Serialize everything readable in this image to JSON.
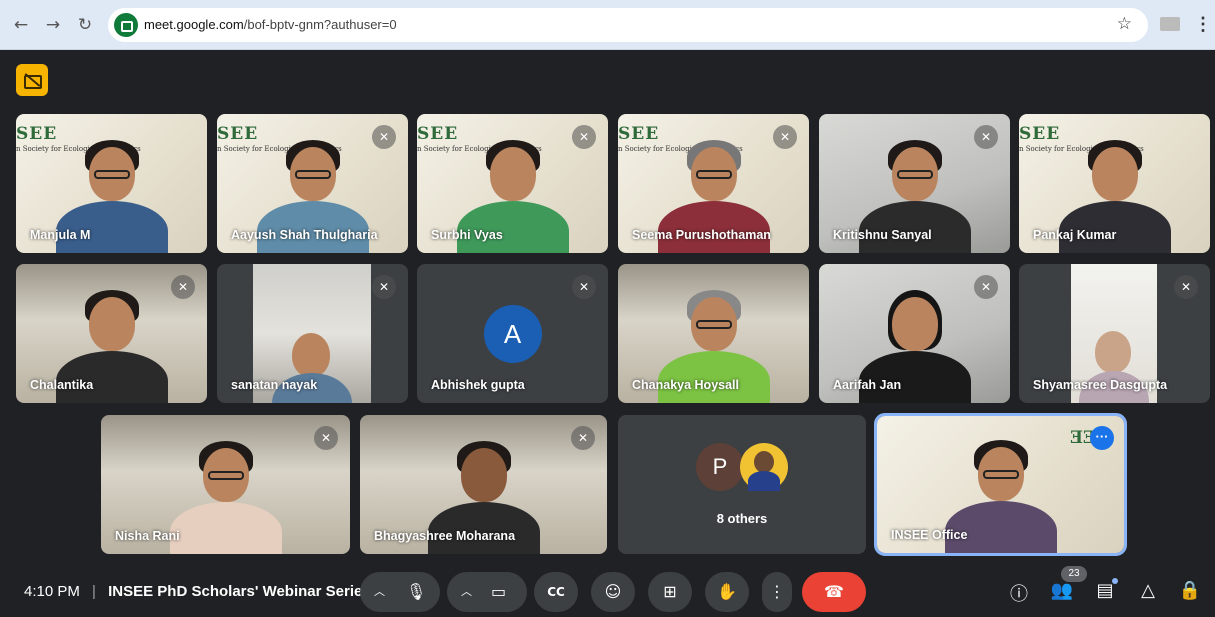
{
  "browser": {
    "url_host": "meet.google.com",
    "url_path": "/bof-bptv-gnm?authuser=0"
  },
  "banner": {
    "big": "SEE",
    "small": "n Society for Ecological Economics"
  },
  "tiles": [
    {
      "name": "Manjula M",
      "muted": false
    },
    {
      "name": "Aayush Shah Thulgharia",
      "muted": true
    },
    {
      "name": "Surbhi Vyas",
      "muted": true
    },
    {
      "name": "Seema Purushothaman",
      "muted": true
    },
    {
      "name": "Kritishnu Sanyal",
      "muted": true
    },
    {
      "name": "Pankaj Kumar",
      "muted": true
    },
    {
      "name": "Chalantika",
      "muted": true
    },
    {
      "name": "sanatan nayak",
      "muted": true
    },
    {
      "name": "Abhishek gupta",
      "muted": true,
      "avatar_letter": "A"
    },
    {
      "name": "Chanakya Hoysall",
      "muted": false
    },
    {
      "name": "Aarifah Jan",
      "muted": true
    },
    {
      "name": "Shyamasree Dasgupta",
      "muted": true
    },
    {
      "name": "Nisha Rani",
      "muted": true
    },
    {
      "name": "Bhagyashree Moharana",
      "muted": true
    },
    {
      "name": "INSEE Office",
      "muted": false
    }
  ],
  "others_tile": {
    "avatar_letter": "P",
    "label": "8 others"
  },
  "insee_banner": "SEE",
  "bottom": {
    "time": "4:10 PM",
    "separator": "|",
    "meeting_title": "INSEE PhD Scholars' Webinar Serie...",
    "people_count": "23"
  },
  "icons": {
    "mic": "microphone-icon",
    "camera": "camera-icon",
    "captions": "captions-icon",
    "emoji": "emoji-icon",
    "present": "present-icon",
    "hand": "raise-hand-icon",
    "more": "more-options-icon",
    "end": "end-call-icon",
    "info": "info-icon",
    "people": "people-icon",
    "chat": "chat-icon",
    "activities": "activities-icon",
    "host": "host-controls-icon"
  },
  "colors": {
    "accent": "#1a73e8",
    "end_call": "#ea4335",
    "camera_warning": "#f6b400",
    "background": "#202124"
  }
}
